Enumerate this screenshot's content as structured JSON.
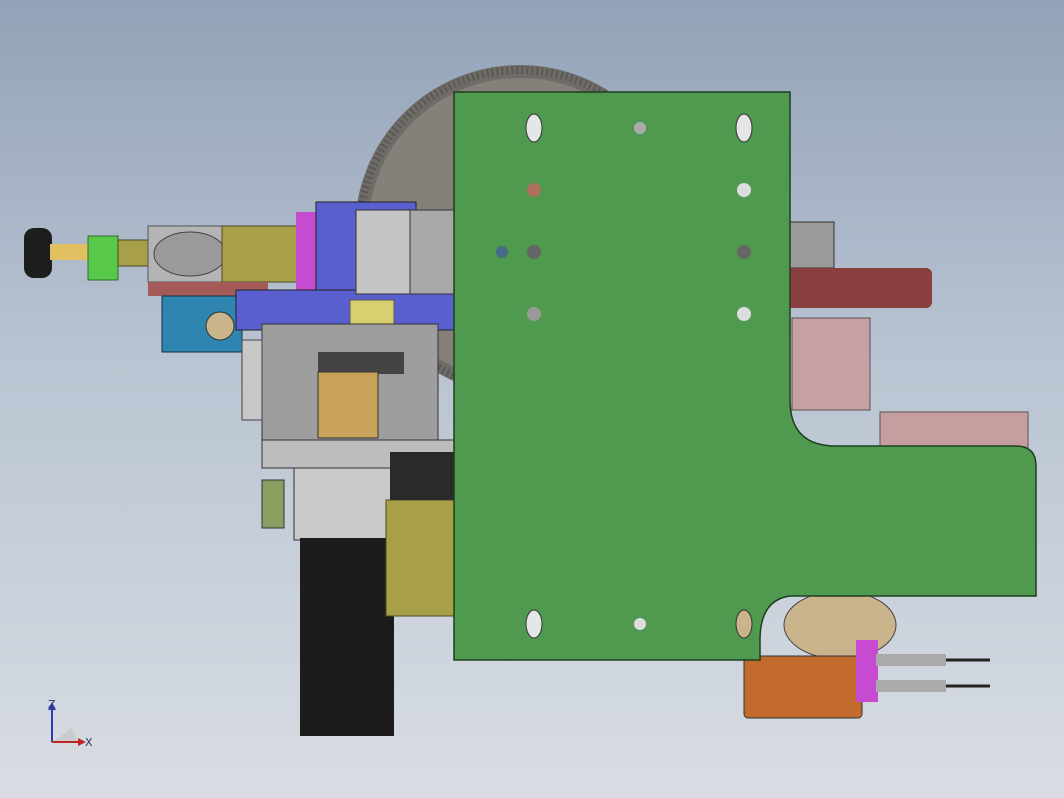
{
  "viewport": {
    "background_top": "#93a2b8",
    "background_bottom": "#d9dde3"
  },
  "colors": {
    "plate_green": "#4f9a4f",
    "gear_gray": "#7d7a75",
    "block_blue": "#5a5fd0",
    "block_teal": "#2e86b0",
    "motor_black": "#1c1c1c",
    "olive": "#a7a048",
    "maroon": "#8a3f3f",
    "pink": "#c79ea0",
    "orange": "#c36a2d",
    "magenta": "#c64bd0",
    "light_green": "#6ccf55",
    "metal_gray": "#b8b8b8"
  },
  "triad": {
    "z_label": "Z",
    "x_label": "X",
    "icon": "coordinate-triad-icon"
  }
}
